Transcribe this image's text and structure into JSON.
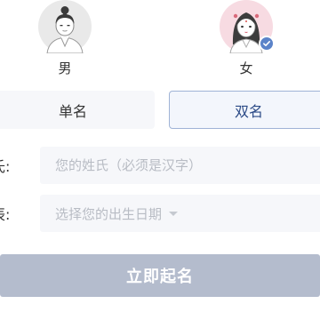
{
  "gender": {
    "male_label": "男",
    "female_label": "女",
    "selected": "female"
  },
  "name_type": {
    "single_label": "单名",
    "double_label": "双名",
    "selected": "double"
  },
  "form": {
    "surname_label": "氏:",
    "surname_placeholder": "您的姓氏（必须是汉字）",
    "birth_label": "辰:",
    "birth_placeholder": "选择您的出生日期"
  },
  "submit_label": "立即起名",
  "colors": {
    "accent": "#5b83c9",
    "selected_border": "#9fb3d6",
    "field_bg": "#f6f7fa",
    "submit_bg": "#b4bccd"
  },
  "icons": {
    "male_avatar": "male-avatar-icon",
    "female_avatar": "female-avatar-icon",
    "selected_badge": "check-icon",
    "dropdown": "caret-down-icon"
  }
}
